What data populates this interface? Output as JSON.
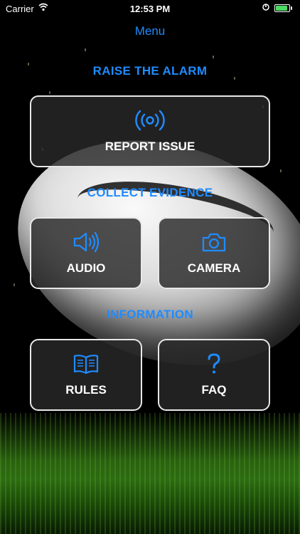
{
  "status": {
    "carrier": "Carrier",
    "time": "12:53 PM"
  },
  "nav": {
    "title": "Menu"
  },
  "sections": {
    "alarm": "RAISE THE ALARM",
    "evidence": "COLLECT EVIDENCE",
    "information": "INFORMATION"
  },
  "buttons": {
    "report_issue": {
      "label": "REPORT ISSUE",
      "icon": "broadcast-icon"
    },
    "audio": {
      "label": "AUDIO",
      "icon": "speaker-icon"
    },
    "camera": {
      "label": "CAMERA",
      "icon": "camera-icon"
    },
    "rules": {
      "label": "RULES",
      "icon": "open-book-icon"
    },
    "faq": {
      "label": "FAQ",
      "icon": "question-mark-icon"
    }
  },
  "colors": {
    "accent": "#1f8bff",
    "button_bg": "#282828",
    "border": "#e8e8e8",
    "battery": "#4cd964"
  }
}
